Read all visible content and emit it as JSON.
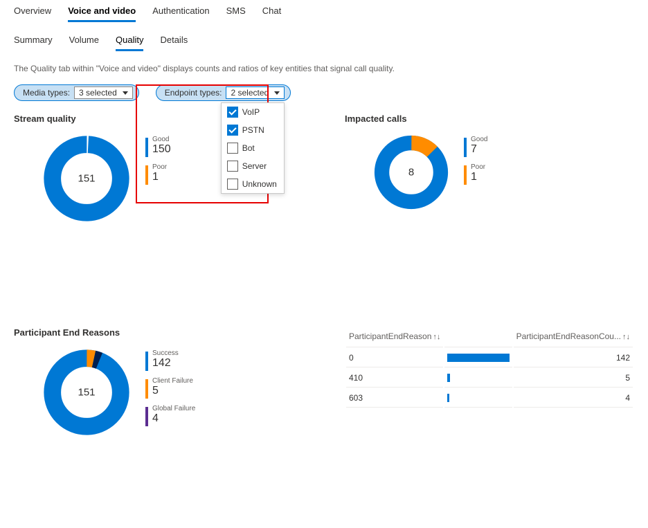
{
  "top_tabs": [
    "Overview",
    "Voice and video",
    "Authentication",
    "SMS",
    "Chat"
  ],
  "top_active": "Voice and video",
  "sub_tabs": [
    "Summary",
    "Volume",
    "Quality",
    "Details"
  ],
  "sub_active": "Quality",
  "description": "The Quality tab within \"Voice and video\" displays counts and ratios of key entities that signal call quality.",
  "filter_media": {
    "label": "Media types:",
    "value": "3 selected"
  },
  "filter_endpoint": {
    "label": "Endpoint types:",
    "value": "2 selected",
    "options": [
      {
        "label": "VoIP",
        "checked": true
      },
      {
        "label": "PSTN",
        "checked": true
      },
      {
        "label": "Bot",
        "checked": false
      },
      {
        "label": "Server",
        "checked": false
      },
      {
        "label": "Unknown",
        "checked": false
      }
    ]
  },
  "panels": {
    "stream": {
      "title": "Stream quality",
      "total": "151",
      "legend": [
        {
          "label": "Good",
          "value": "150",
          "color": "#0078d4"
        },
        {
          "label": "Poor",
          "value": "1",
          "color": "#ff8c00"
        }
      ]
    },
    "impacted": {
      "title": "Impacted calls",
      "total": "8",
      "legend": [
        {
          "label": "Good",
          "value": "7",
          "color": "#0078d4"
        },
        {
          "label": "Poor",
          "value": "1",
          "color": "#ff8c00"
        }
      ]
    },
    "reasons": {
      "title": "Participant End Reasons",
      "total": "151",
      "legend": [
        {
          "label": "Success",
          "value": "142",
          "color": "#0078d4"
        },
        {
          "label": "Client Failure",
          "value": "5",
          "color": "#ff8c00"
        },
        {
          "label": "Global Failure",
          "value": "4",
          "color": "#5c2e91"
        }
      ]
    },
    "table": {
      "col1": "ParticipantEndReason",
      "col2": "ParticipantEndReasonCou...",
      "rows": [
        {
          "reason": "0",
          "count": "142",
          "bar": 100
        },
        {
          "reason": "410",
          "count": "5",
          "bar": 3.5
        },
        {
          "reason": "603",
          "count": "4",
          "bar": 2.8
        }
      ]
    }
  },
  "chart_data": [
    {
      "type": "pie",
      "title": "Stream quality",
      "series": [
        {
          "name": "Good",
          "value": 150
        },
        {
          "name": "Poor",
          "value": 1
        }
      ],
      "total": 151
    },
    {
      "type": "pie",
      "title": "Impacted calls",
      "series": [
        {
          "name": "Good",
          "value": 7
        },
        {
          "name": "Poor",
          "value": 1
        }
      ],
      "total": 8
    },
    {
      "type": "pie",
      "title": "Participant End Reasons",
      "series": [
        {
          "name": "Success",
          "value": 142
        },
        {
          "name": "Client Failure",
          "value": 5
        },
        {
          "name": "Global Failure",
          "value": 4
        }
      ],
      "total": 151
    },
    {
      "type": "bar",
      "title": "ParticipantEndReasonCount",
      "categories": [
        "0",
        "410",
        "603"
      ],
      "values": [
        142,
        5,
        4
      ]
    }
  ]
}
